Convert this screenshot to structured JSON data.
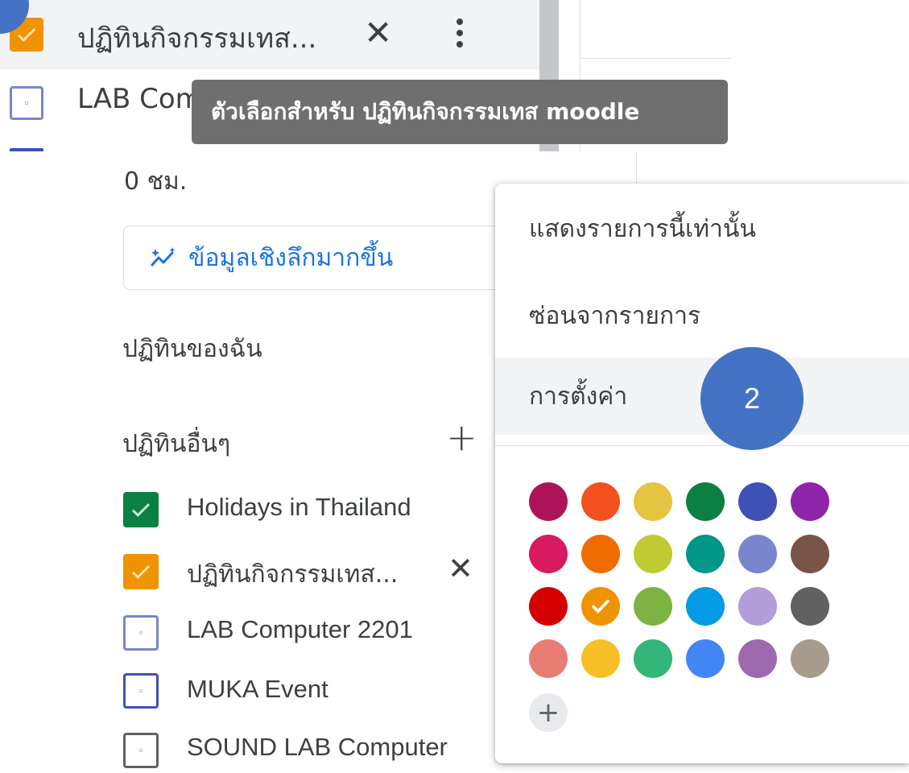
{
  "top_list": {
    "item1_label": "ปฏิทินกิจกรรมเทส...",
    "item1_color": "#f09300",
    "item2_label": "LAB Computer 2201"
  },
  "tooltip": {
    "text": "ตัวเลือกสำหรับ ปฏิทินกิจกรรมเทส moodle"
  },
  "sidebar": {
    "hours_text": "0 ชม.",
    "insights_button": "ข้อมูลเชิงลึกมากขึ้น",
    "my_calendars_title": "ปฏิทินของฉัน",
    "other_calendars_title": "ปฏิทินอื่นๆ",
    "other_calendars": [
      {
        "label": "Holidays in Thailand",
        "checked": true,
        "color": "#0b8043"
      },
      {
        "label": "ปฏิทินกิจกรรมเทส...",
        "checked": true,
        "color": "#f09300"
      },
      {
        "label": "LAB Computer 2201",
        "checked": false,
        "color": "#7986cb"
      },
      {
        "label": "MUKA Event",
        "checked": false,
        "color": "#3f51b5"
      },
      {
        "label": "SOUND LAB Computer",
        "checked": false,
        "color": "#616161"
      }
    ]
  },
  "menu": {
    "items": [
      {
        "label": "แสดงรายการนี้เท่านั้น"
      },
      {
        "label": "ซ่อนจากรายการ"
      },
      {
        "label": "การตั้งค่า"
      }
    ],
    "palette": [
      [
        "#ad1457",
        "#f4511e",
        "#e4c441",
        "#0b8043",
        "#3f51b5",
        "#8e24aa"
      ],
      [
        "#d81b60",
        "#ef6c00",
        "#c0ca33",
        "#009688",
        "#7986cb",
        "#795548"
      ],
      [
        "#d50000",
        "#f09300",
        "#7cb342",
        "#039be5",
        "#b39ddb",
        "#616161"
      ],
      [
        "#e67c73",
        "#f6bf26",
        "#33b679",
        "#4285f4",
        "#9e69af",
        "#a79b8e"
      ]
    ],
    "selected_color": "#f09300"
  },
  "annotations": {
    "step2": "2"
  }
}
